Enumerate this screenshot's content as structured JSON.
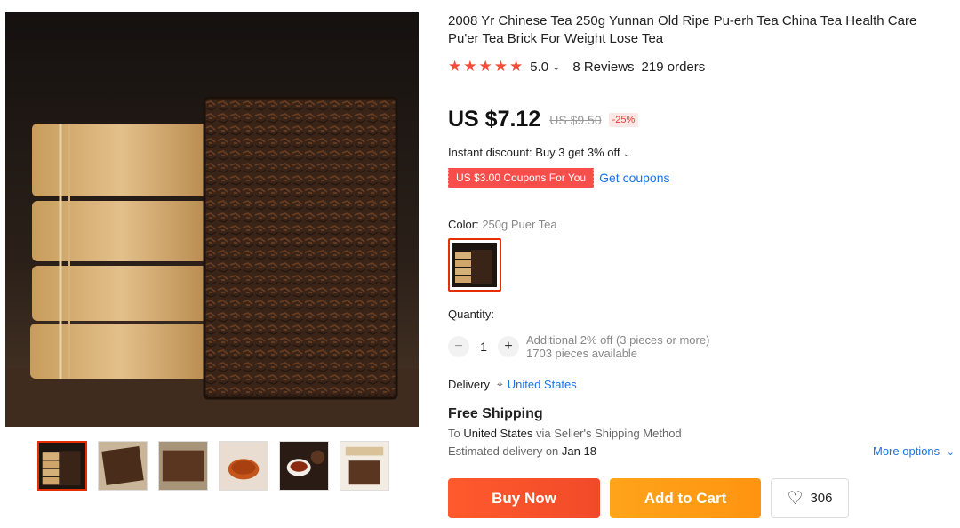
{
  "gallery": {
    "main_image": "pu-erh tea bricks photo",
    "thumbnails": [
      "tea brick stack",
      "tea brick close-up",
      "pressed tea brick",
      "brewed tea cup",
      "tea bowl",
      "tea brick with packaging"
    ]
  },
  "product": {
    "title": "2008 Yr Chinese Tea 250g Yunnan Old Ripe Pu-erh Tea China Tea Health Care Pu'er Tea Brick For Weight Lose Tea",
    "rating_score": "5.0",
    "reviews": "8 Reviews",
    "orders": "219 orders",
    "price": "US $7.12",
    "old_price": "US $9.50",
    "discount": "-25%",
    "instant_discount": "Instant discount: Buy 3 get 3% off",
    "coupon_label": "US $3.00 Coupons For You",
    "get_coupons": "Get coupons"
  },
  "color": {
    "label": "Color:",
    "value": "250g Puer Tea"
  },
  "quantity": {
    "label": "Quantity:",
    "minus": "−",
    "value": "1",
    "plus": "+",
    "additional": "Additional 2% off (3 pieces or more)",
    "available": "1703 pieces available"
  },
  "delivery": {
    "label": "Delivery",
    "country": "United States",
    "free_shipping": "Free Shipping",
    "to_prefix": "To",
    "to_country": "United States",
    "via": "via Seller's Shipping Method",
    "est_prefix": "Estimated delivery on",
    "est_date": "Jan 18",
    "more_options": "More options"
  },
  "actions": {
    "buy_now": "Buy Now",
    "add_to_cart": "Add to Cart",
    "wishlist_count": "306"
  },
  "colors": {
    "accent_red": "#e62e04",
    "star": "#f44b3a",
    "link": "#1a73e8",
    "buy": "#f14a29",
    "cart": "#ff9410"
  }
}
